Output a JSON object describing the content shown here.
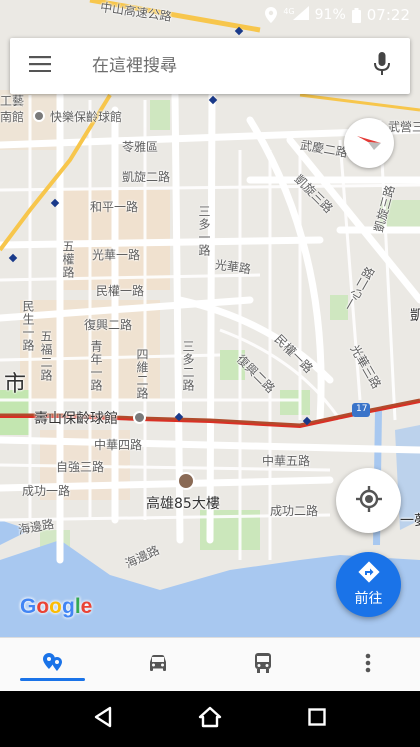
{
  "status_bar": {
    "network_type": "4G",
    "battery": "91%",
    "time": "07:22",
    "icons": [
      "location-pin-icon",
      "signal-icon",
      "battery-icon"
    ]
  },
  "search": {
    "placeholder": "在這裡搜尋",
    "value": ""
  },
  "map_labels": {
    "zhongshan_expressway": "中山高速公路",
    "works": "工藝",
    "temple": "南館",
    "happy_bowling": "快樂保齡球館",
    "lingya_district": "苓雅區",
    "kaixuan2": "凱旋二路",
    "heping1": "和平一路",
    "guanghua1": "光華一路",
    "guanghua_road": "光華路",
    "minquan1": "民權一路",
    "fuxing2": "復興二路",
    "wufu2": "五福二路",
    "qingnian1": "青年一路",
    "sihwei2": "四維二路",
    "sanduo2": "三多二路",
    "minquan_road": "民權一路",
    "fuxing_road": "復興二路",
    "guanghua3": "光華三路",
    "kaixuan3": "凱旋三路",
    "yixin2": "一心二路",
    "wuchang2": "武慶二路",
    "wuchang3": "武營三路",
    "kaixuan_road": "凱旋三路",
    "sanduo1": "三多一路",
    "wuquan": "五權路",
    "minsheng": "民生一路",
    "shi": "市",
    "shoushan_bowling": "壽山保齡球館",
    "zhonghua4": "中華四路",
    "zhonghua5": "中華五路",
    "ziqiang": "自強三路",
    "chenggong1": "成功一路",
    "chenggong2": "成功二路",
    "haibian": "海邊路",
    "tower85": "高雄85大樓",
    "yimeng": "一夢",
    "route17": "17",
    "hai": "凱"
  },
  "go_button": {
    "label": "前往"
  },
  "logo": {
    "letters": [
      "G",
      "o",
      "o",
      "g",
      "l",
      "e"
    ]
  },
  "tabs": [
    {
      "name": "explore",
      "icon": "explore-pin-icon",
      "active": true
    },
    {
      "name": "driving",
      "icon": "car-icon",
      "active": false
    },
    {
      "name": "transit",
      "icon": "transit-icon",
      "active": false
    },
    {
      "name": "more",
      "icon": "more-vert-icon",
      "active": false
    }
  ],
  "colors": {
    "accent": "#1a73e8",
    "route_red": "#d93025",
    "water": "#a8c8f0",
    "park": "#c3e6b0",
    "land": "#ebe9e4"
  }
}
